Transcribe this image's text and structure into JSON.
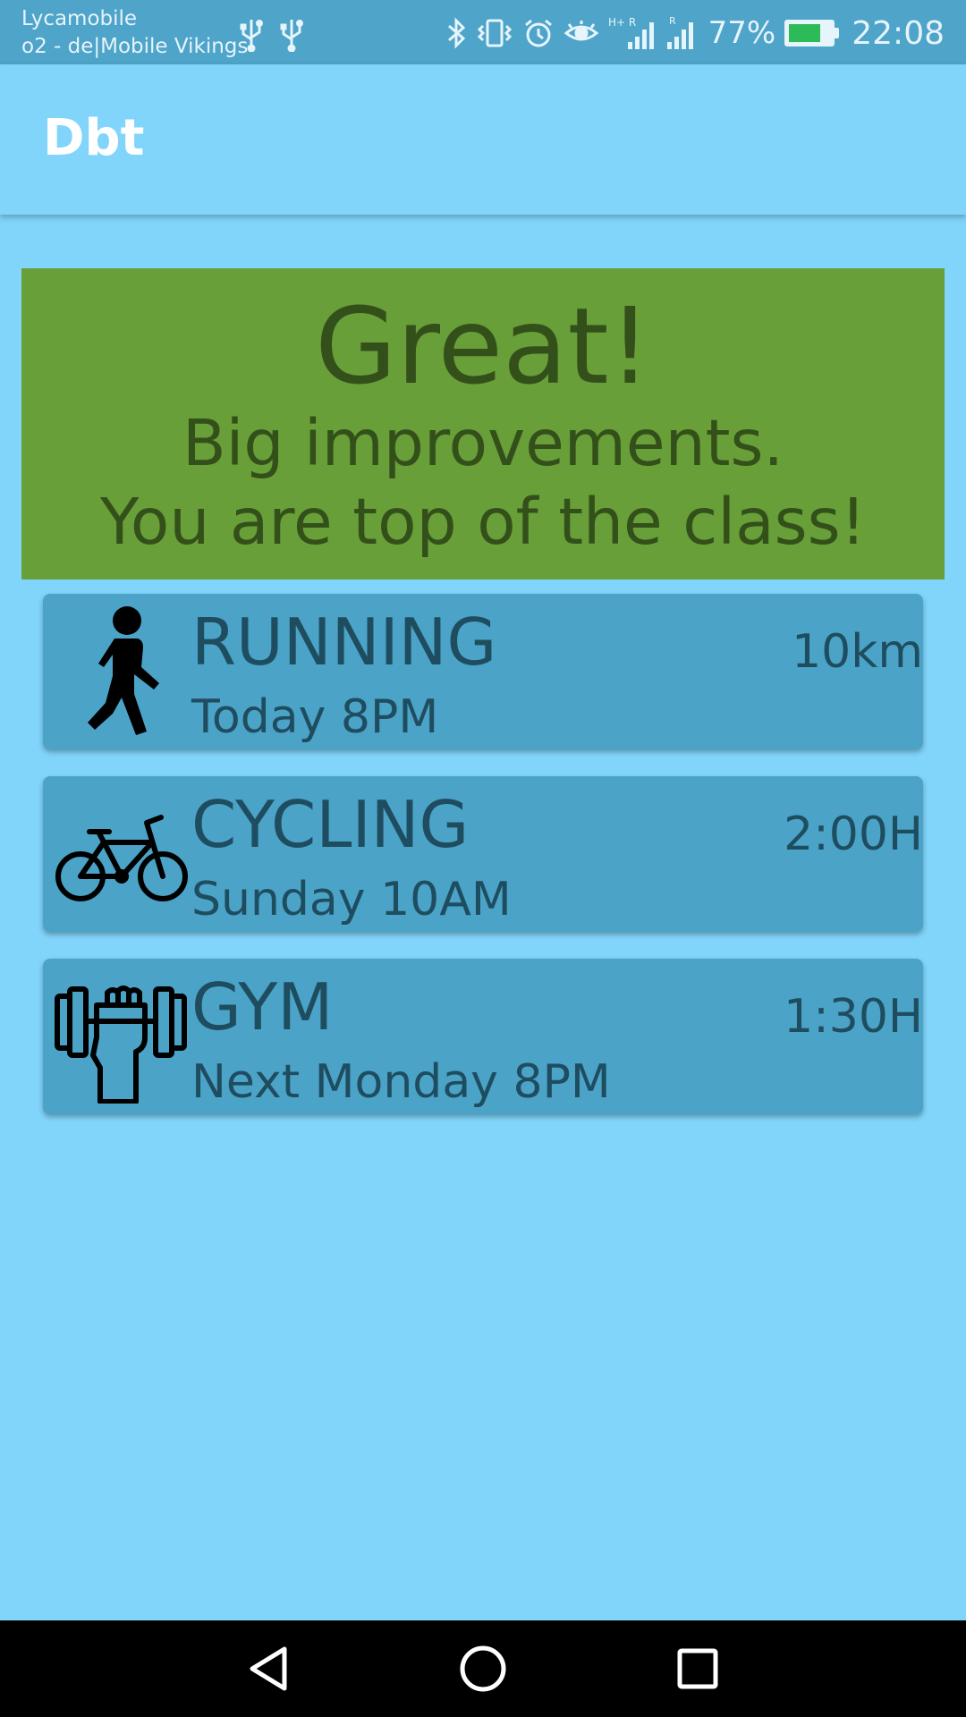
{
  "status_bar": {
    "carrier_line1": "Lycamobile",
    "carrier_line2": "o2 - de|Mobile Vikings",
    "battery_percent": "77%",
    "battery_level": 0.77,
    "time": "22:08",
    "icons": [
      "usb-icon",
      "usb-icon",
      "bluetooth-icon",
      "vibrate-icon",
      "alarm-icon",
      "eye-icon",
      "signal-icon",
      "signal-icon",
      "battery-icon"
    ]
  },
  "app_bar": {
    "title": "Dbt"
  },
  "banner": {
    "headline": "Great!",
    "line1": "Big improvements.",
    "line2": "You are top of the class!",
    "background": "#689f38",
    "text_color": "#33501b"
  },
  "activities": [
    {
      "icon": "running-person-icon",
      "title": "RUNNING",
      "time": "Today 8PM",
      "amount": "10km"
    },
    {
      "icon": "bicycle-icon",
      "title": "CYCLING",
      "time": "Sunday 10AM",
      "amount": "2:00H"
    },
    {
      "icon": "dumbbell-fist-icon",
      "title": "GYM",
      "time": "Next Monday 8PM",
      "amount": "1:30H"
    }
  ],
  "colors": {
    "page_background": "#81d4fa",
    "status_bar": "#4ea4c9",
    "card": "#4ba3c8",
    "card_text": "#1f4d60"
  },
  "nav_bar": {
    "buttons": [
      "back-icon",
      "home-icon",
      "recents-icon"
    ]
  }
}
